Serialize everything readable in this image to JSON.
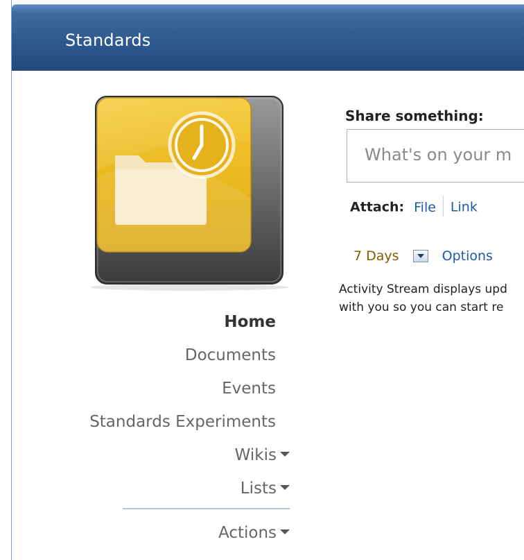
{
  "header": {
    "title": "Standards"
  },
  "logo": {
    "icon": "folder-clock-icon",
    "colors": {
      "gold": "#e7b823",
      "frame": "#575757"
    }
  },
  "nav": {
    "items": [
      {
        "label": "Home",
        "active": true
      },
      {
        "label": "Documents"
      },
      {
        "label": "Events"
      },
      {
        "label": "Standards Experiments"
      },
      {
        "label": "Wikis",
        "dropdown": true
      },
      {
        "label": "Lists",
        "dropdown": true
      },
      {
        "label": "Actions",
        "dropdown": true
      }
    ]
  },
  "share": {
    "label": "Share something:",
    "placeholder": "What's on your m"
  },
  "attach": {
    "label": "Attach:",
    "file": "File",
    "link": "Link"
  },
  "filter": {
    "days": "7 Days",
    "options": "Options"
  },
  "stream": {
    "line1": "Activity Stream displays upd",
    "line2": "with you so you can start re"
  },
  "colors": {
    "header": "#2f5a90",
    "link": "#1a5aa8",
    "days": "#8b5a00"
  }
}
